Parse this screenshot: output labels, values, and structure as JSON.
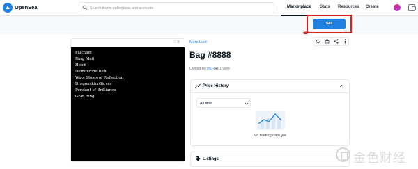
{
  "app": {
    "name": "OpenSea"
  },
  "search": {
    "placeholder": "Search items, collections, and accounts"
  },
  "nav": {
    "marketplace": "Marketplace",
    "stats": "Stats",
    "resources": "Resources",
    "create": "Create"
  },
  "sell_button": "Sell",
  "like_count": "0",
  "collection_link": "More Loot",
  "item": {
    "title": "Bag #8888",
    "owned_by_label": "Owned by",
    "owner": "you",
    "views": "1 view",
    "lines": [
      "Falchion",
      "Ring Mail",
      "Hood",
      "Demonhide Belt",
      "Wool Shoes of Reflection",
      "Dragonskin Gloves",
      "Pendant of Brilliance",
      "Gold Ring"
    ]
  },
  "price_history": {
    "title": "Price History",
    "period": "All time",
    "empty_text": "No trading data yet"
  },
  "listings": {
    "title": "Listings"
  },
  "watermark": {
    "text": "金色财经"
  },
  "colors": {
    "accent": "#2081e2",
    "highlight": "#e02020",
    "image_bg": "#000000"
  },
  "icons": [
    "opensea-logo",
    "search-icon",
    "avatar",
    "wallet-icon",
    "heart-icon",
    "refresh-icon",
    "transfer-icon",
    "share-icon",
    "more-icon",
    "eye-icon",
    "trend-icon",
    "chevron-up-icon",
    "chevron-down-icon",
    "tag-icon"
  ]
}
